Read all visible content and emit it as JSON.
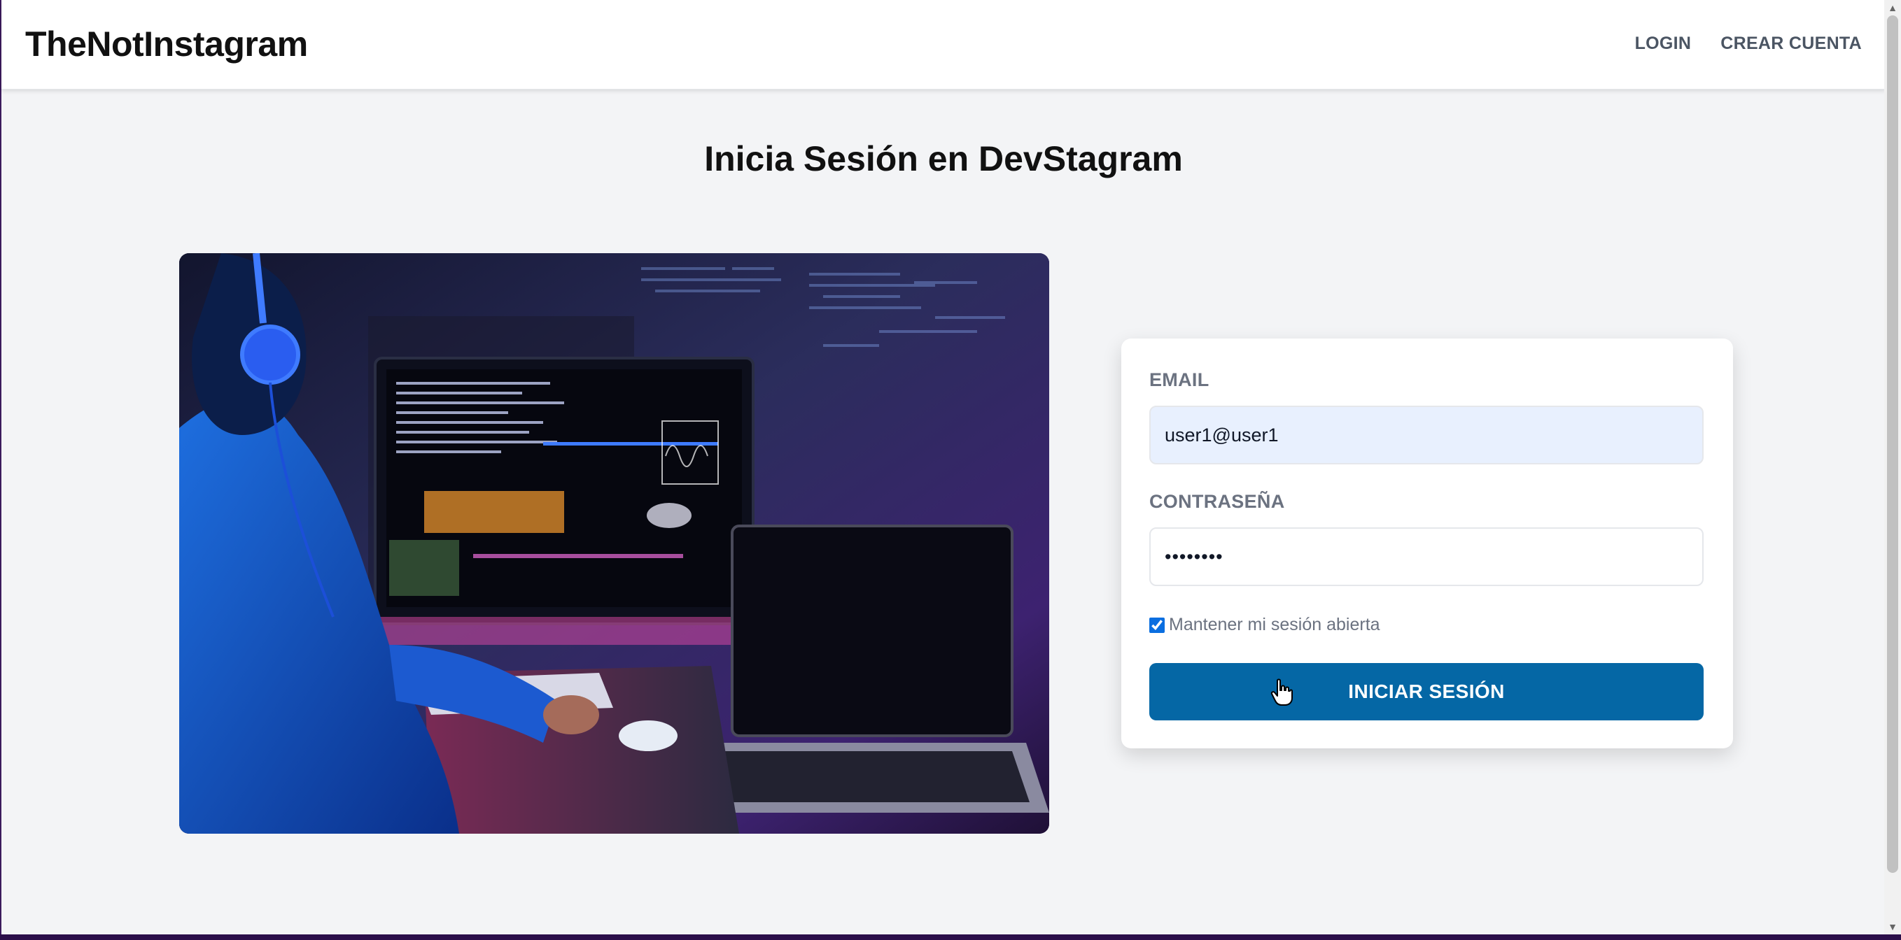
{
  "header": {
    "brand": "TheNotInstagram",
    "nav": {
      "login": "LOGIN",
      "register": "CREAR CUENTA"
    }
  },
  "main": {
    "title": "Inicia Sesión en DevStagram",
    "form": {
      "email_label": "EMAIL",
      "email_value": "user1@user1",
      "password_label": "CONTRASEÑA",
      "password_value": "••••••••",
      "remember_label": "Mantener mi sesión abierta",
      "remember_checked": true,
      "submit_label": "INICIAR SESIÓN"
    }
  },
  "colors": {
    "primary_button": "#0567a5",
    "email_autofill_bg": "#e8f0fe",
    "page_bg": "#f3f4f6"
  },
  "icons": {
    "cursor": "hand-pointer-icon",
    "scroll_up": "scroll-up-arrow-icon",
    "scroll_down": "scroll-down-arrow-icon"
  }
}
